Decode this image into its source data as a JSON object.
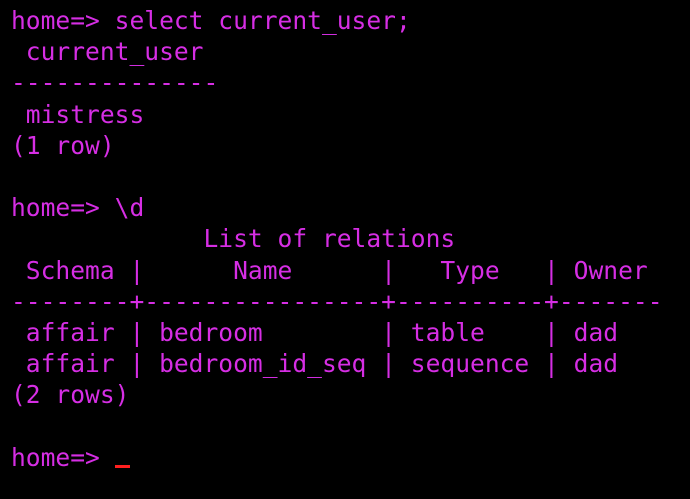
{
  "terminal": {
    "colors": {
      "background": "#000000",
      "text": "#d62ee4",
      "cursor": "#ff1f1f"
    },
    "lines": [
      "home=> select current_user;",
      " current_user",
      "--------------",
      " mistress",
      "(1 row)",
      "",
      "home=> \\d",
      "             List of relations",
      " Schema |      Name      |   Type   | Owner",
      "--------+----------------+----------+-------",
      " affair | bedroom        | table    | dad",
      " affair | bedroom_id_seq | sequence | dad",
      "(2 rows)",
      "",
      "home=> "
    ]
  }
}
